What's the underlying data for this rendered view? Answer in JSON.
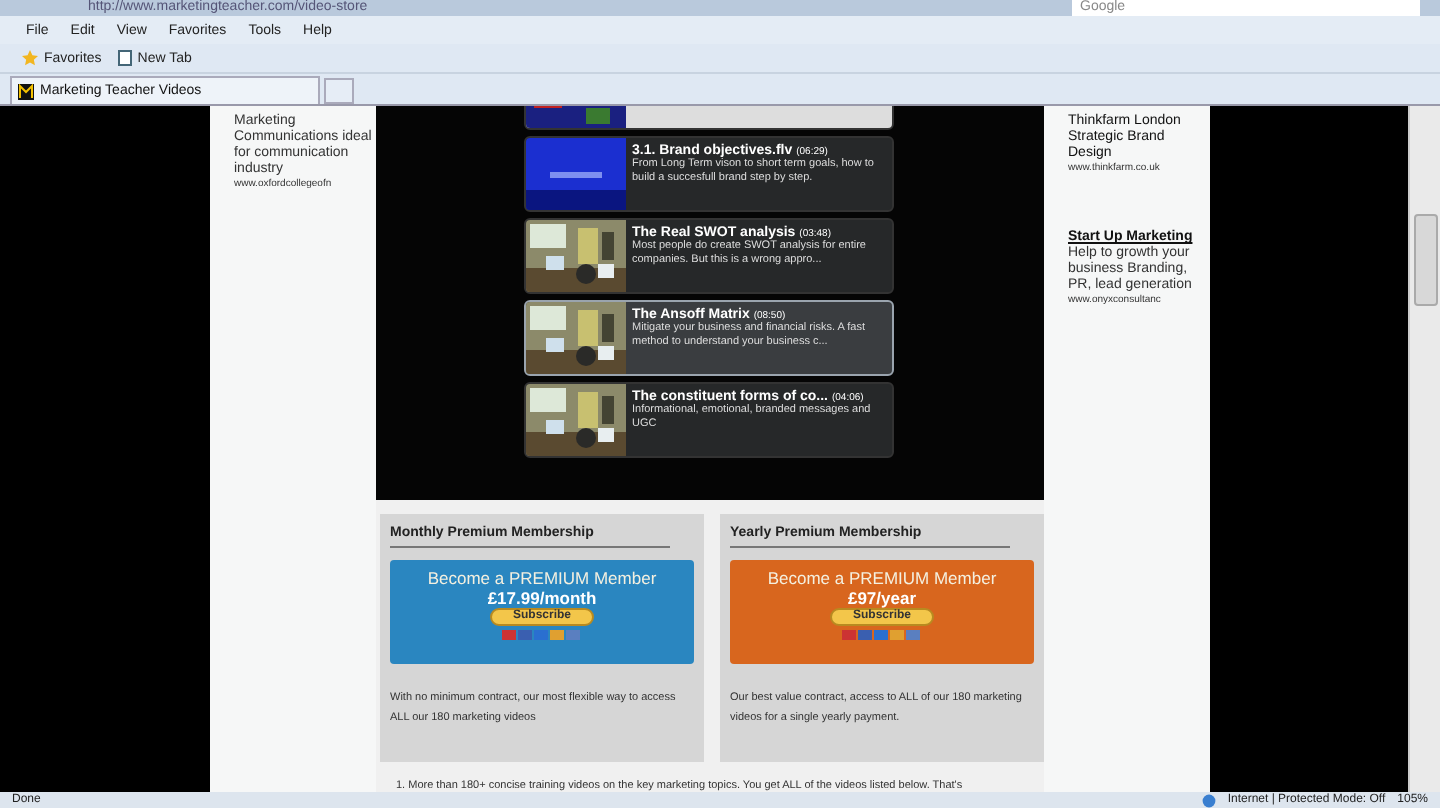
{
  "address_bar": {
    "url": "http://www.marketingteacher.com/video-store",
    "search_placeholder": "Google"
  },
  "menu": [
    "File",
    "Edit",
    "View",
    "Favorites",
    "Tools",
    "Help"
  ],
  "favorites_bar": {
    "favorites": "Favorites",
    "new_tab": "New Tab"
  },
  "tabs": [
    {
      "label": "Marketing Teacher Videos",
      "selected": true
    }
  ],
  "left_ad": {
    "text": "Marketing Communications ideal for communication industry",
    "url": "www.oxfordcollegeofn"
  },
  "videos": [
    {
      "kind": "partial"
    },
    {
      "kind": "slide",
      "title": "3.1. Brand objectives.flv",
      "duration": "(06:29)",
      "description": "From Long Term vison to short term goals, how to build a succesfull brand step by step.",
      "selected": false
    },
    {
      "kind": "video",
      "title": "The Real SWOT analysis",
      "duration": "(03:48)",
      "description": "Most people do create SWOT analysis for entire companies. But this is a wrong appro...",
      "selected": false
    },
    {
      "kind": "video",
      "title": "The Ansoff Matrix",
      "duration": "(08:50)",
      "description": "Mitigate your business and financial risks. A fast method to understand your business c...",
      "selected": true
    },
    {
      "kind": "video",
      "title": "The constituent forms of co...",
      "duration": "(04:06)",
      "description": "Informational, emotional, branded messages and UGC",
      "selected": false
    }
  ],
  "memberships": [
    {
      "heading": "Monthly Premium Membership",
      "banner_title": "Become a PREMIUM Member",
      "price": "£17.99/month",
      "button": "Subscribe",
      "color": "#2a86c0",
      "description": "With no minimum contract, our most flexible way to access ALL our 180 marketing videos"
    },
    {
      "heading": "Yearly Premium Membership",
      "banner_title": "Become a PREMIUM Member",
      "price": "£97/year",
      "button": "Subscribe",
      "color": "#d8661e",
      "description": "Our best value contract, access to ALL of our 180 marketing videos for a single yearly payment."
    }
  ],
  "footnote": "1.  More than 180+ concise training videos on the key marketing topics. You get ALL of the videos listed below. That's",
  "right_ads": [
    {
      "title": "Thinkfarm London Strategic Brand Design",
      "url": "www.thinkfarm.co.uk"
    },
    {
      "title": "Start Up Marketing",
      "text": "Help to growth your business Branding, PR, lead generation",
      "url": "www.onyxconsultanc"
    }
  ],
  "status_bar": {
    "left": "Done",
    "zone": "Internet | Protected Mode: Off",
    "zoom": "105%"
  }
}
